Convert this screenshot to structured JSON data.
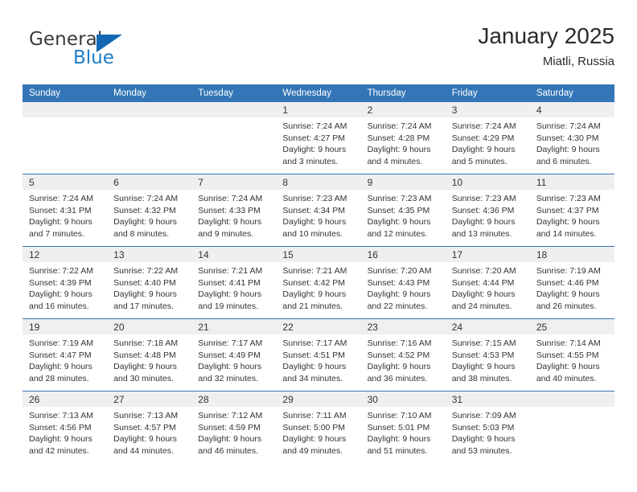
{
  "logo": {
    "word_top": "General",
    "word_bottom": "Blue",
    "triangle_color": "#1268b3",
    "blue_color": "#1d7cc4"
  },
  "header": {
    "title": "January 2025",
    "location": "Miatli, Russia"
  },
  "theme": {
    "header_blue": "#3375b6",
    "daynum_band": "#efefef",
    "text": "#333333"
  },
  "weekday_headers": [
    "Sunday",
    "Monday",
    "Tuesday",
    "Wednesday",
    "Thursday",
    "Friday",
    "Saturday"
  ],
  "labels": {
    "sunrise_prefix": "Sunrise: ",
    "sunset_prefix": "Sunset: ",
    "daylight_prefix": "Daylight: "
  },
  "weeks": [
    [
      {
        "empty": true
      },
      {
        "empty": true
      },
      {
        "empty": true
      },
      {
        "day": "1",
        "sunrise": "Sunrise: 7:24 AM",
        "sunset": "Sunset: 4:27 PM",
        "daylight1": "Daylight: 9 hours",
        "daylight2": "and 3 minutes."
      },
      {
        "day": "2",
        "sunrise": "Sunrise: 7:24 AM",
        "sunset": "Sunset: 4:28 PM",
        "daylight1": "Daylight: 9 hours",
        "daylight2": "and 4 minutes."
      },
      {
        "day": "3",
        "sunrise": "Sunrise: 7:24 AM",
        "sunset": "Sunset: 4:29 PM",
        "daylight1": "Daylight: 9 hours",
        "daylight2": "and 5 minutes."
      },
      {
        "day": "4",
        "sunrise": "Sunrise: 7:24 AM",
        "sunset": "Sunset: 4:30 PM",
        "daylight1": "Daylight: 9 hours",
        "daylight2": "and 6 minutes."
      }
    ],
    [
      {
        "day": "5",
        "sunrise": "Sunrise: 7:24 AM",
        "sunset": "Sunset: 4:31 PM",
        "daylight1": "Daylight: 9 hours",
        "daylight2": "and 7 minutes."
      },
      {
        "day": "6",
        "sunrise": "Sunrise: 7:24 AM",
        "sunset": "Sunset: 4:32 PM",
        "daylight1": "Daylight: 9 hours",
        "daylight2": "and 8 minutes."
      },
      {
        "day": "7",
        "sunrise": "Sunrise: 7:24 AM",
        "sunset": "Sunset: 4:33 PM",
        "daylight1": "Daylight: 9 hours",
        "daylight2": "and 9 minutes."
      },
      {
        "day": "8",
        "sunrise": "Sunrise: 7:23 AM",
        "sunset": "Sunset: 4:34 PM",
        "daylight1": "Daylight: 9 hours",
        "daylight2": "and 10 minutes."
      },
      {
        "day": "9",
        "sunrise": "Sunrise: 7:23 AM",
        "sunset": "Sunset: 4:35 PM",
        "daylight1": "Daylight: 9 hours",
        "daylight2": "and 12 minutes."
      },
      {
        "day": "10",
        "sunrise": "Sunrise: 7:23 AM",
        "sunset": "Sunset: 4:36 PM",
        "daylight1": "Daylight: 9 hours",
        "daylight2": "and 13 minutes."
      },
      {
        "day": "11",
        "sunrise": "Sunrise: 7:23 AM",
        "sunset": "Sunset: 4:37 PM",
        "daylight1": "Daylight: 9 hours",
        "daylight2": "and 14 minutes."
      }
    ],
    [
      {
        "day": "12",
        "sunrise": "Sunrise: 7:22 AM",
        "sunset": "Sunset: 4:39 PM",
        "daylight1": "Daylight: 9 hours",
        "daylight2": "and 16 minutes."
      },
      {
        "day": "13",
        "sunrise": "Sunrise: 7:22 AM",
        "sunset": "Sunset: 4:40 PM",
        "daylight1": "Daylight: 9 hours",
        "daylight2": "and 17 minutes."
      },
      {
        "day": "14",
        "sunrise": "Sunrise: 7:21 AM",
        "sunset": "Sunset: 4:41 PM",
        "daylight1": "Daylight: 9 hours",
        "daylight2": "and 19 minutes."
      },
      {
        "day": "15",
        "sunrise": "Sunrise: 7:21 AM",
        "sunset": "Sunset: 4:42 PM",
        "daylight1": "Daylight: 9 hours",
        "daylight2": "and 21 minutes."
      },
      {
        "day": "16",
        "sunrise": "Sunrise: 7:20 AM",
        "sunset": "Sunset: 4:43 PM",
        "daylight1": "Daylight: 9 hours",
        "daylight2": "and 22 minutes."
      },
      {
        "day": "17",
        "sunrise": "Sunrise: 7:20 AM",
        "sunset": "Sunset: 4:44 PM",
        "daylight1": "Daylight: 9 hours",
        "daylight2": "and 24 minutes."
      },
      {
        "day": "18",
        "sunrise": "Sunrise: 7:19 AM",
        "sunset": "Sunset: 4:46 PM",
        "daylight1": "Daylight: 9 hours",
        "daylight2": "and 26 minutes."
      }
    ],
    [
      {
        "day": "19",
        "sunrise": "Sunrise: 7:19 AM",
        "sunset": "Sunset: 4:47 PM",
        "daylight1": "Daylight: 9 hours",
        "daylight2": "and 28 minutes."
      },
      {
        "day": "20",
        "sunrise": "Sunrise: 7:18 AM",
        "sunset": "Sunset: 4:48 PM",
        "daylight1": "Daylight: 9 hours",
        "daylight2": "and 30 minutes."
      },
      {
        "day": "21",
        "sunrise": "Sunrise: 7:17 AM",
        "sunset": "Sunset: 4:49 PM",
        "daylight1": "Daylight: 9 hours",
        "daylight2": "and 32 minutes."
      },
      {
        "day": "22",
        "sunrise": "Sunrise: 7:17 AM",
        "sunset": "Sunset: 4:51 PM",
        "daylight1": "Daylight: 9 hours",
        "daylight2": "and 34 minutes."
      },
      {
        "day": "23",
        "sunrise": "Sunrise: 7:16 AM",
        "sunset": "Sunset: 4:52 PM",
        "daylight1": "Daylight: 9 hours",
        "daylight2": "and 36 minutes."
      },
      {
        "day": "24",
        "sunrise": "Sunrise: 7:15 AM",
        "sunset": "Sunset: 4:53 PM",
        "daylight1": "Daylight: 9 hours",
        "daylight2": "and 38 minutes."
      },
      {
        "day": "25",
        "sunrise": "Sunrise: 7:14 AM",
        "sunset": "Sunset: 4:55 PM",
        "daylight1": "Daylight: 9 hours",
        "daylight2": "and 40 minutes."
      }
    ],
    [
      {
        "day": "26",
        "sunrise": "Sunrise: 7:13 AM",
        "sunset": "Sunset: 4:56 PM",
        "daylight1": "Daylight: 9 hours",
        "daylight2": "and 42 minutes."
      },
      {
        "day": "27",
        "sunrise": "Sunrise: 7:13 AM",
        "sunset": "Sunset: 4:57 PM",
        "daylight1": "Daylight: 9 hours",
        "daylight2": "and 44 minutes."
      },
      {
        "day": "28",
        "sunrise": "Sunrise: 7:12 AM",
        "sunset": "Sunset: 4:59 PM",
        "daylight1": "Daylight: 9 hours",
        "daylight2": "and 46 minutes."
      },
      {
        "day": "29",
        "sunrise": "Sunrise: 7:11 AM",
        "sunset": "Sunset: 5:00 PM",
        "daylight1": "Daylight: 9 hours",
        "daylight2": "and 49 minutes."
      },
      {
        "day": "30",
        "sunrise": "Sunrise: 7:10 AM",
        "sunset": "Sunset: 5:01 PM",
        "daylight1": "Daylight: 9 hours",
        "daylight2": "and 51 minutes."
      },
      {
        "day": "31",
        "sunrise": "Sunrise: 7:09 AM",
        "sunset": "Sunset: 5:03 PM",
        "daylight1": "Daylight: 9 hours",
        "daylight2": "and 53 minutes."
      },
      {
        "empty": true
      }
    ]
  ]
}
